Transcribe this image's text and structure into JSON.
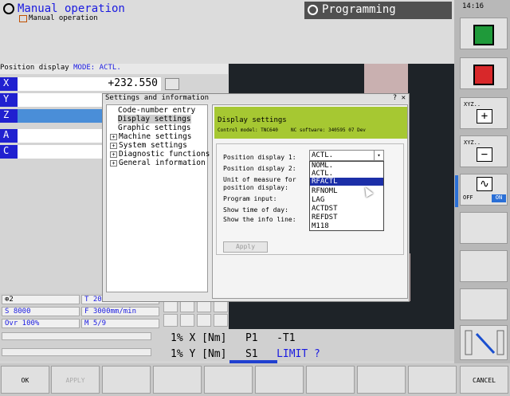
{
  "header": {
    "mode_title": "Manual operation",
    "mode_subtitle": "Manual operation",
    "programming_tab": "Programming",
    "clock": "14:16"
  },
  "position_display": {
    "label": "Position display",
    "mode_prefix": "MODE:",
    "mode_value": "ACTL.",
    "axes": [
      {
        "name": "X",
        "value": "+232.550"
      },
      {
        "name": "Y",
        "value": ""
      },
      {
        "name": "Z",
        "value": ""
      },
      {
        "name": "A",
        "value": ""
      },
      {
        "name": "C",
        "value": ""
      }
    ]
  },
  "settings_dialog": {
    "title": "Settings and information",
    "close_glyph": "? ✕",
    "tree": [
      {
        "label": "Code-number entry",
        "expandable": false
      },
      {
        "label": "Display settings",
        "expandable": false,
        "selected": true
      },
      {
        "label": "Graphic settings",
        "expandable": false
      },
      {
        "label": "Machine settings",
        "expandable": true
      },
      {
        "label": "System settings",
        "expandable": true
      },
      {
        "label": "Diagnostic functions",
        "expandable": true
      },
      {
        "label": "General information",
        "expandable": true
      }
    ],
    "panel": {
      "title": "Display settings",
      "model": "Control model: TNC640",
      "software": "NC software: 340595 07 Dev",
      "fields": [
        "Position display 1:",
        "Position display 2:",
        "Unit of measure for",
        "position display:",
        "Program input:",
        "Show time of day:",
        "Show the info line:"
      ],
      "apply_label": "Apply",
      "combo_value": "ACTL.",
      "combo_arrow": "▾",
      "dropdown_options": [
        "NOML.",
        "ACTL.",
        "RFACTL",
        "RFNOML",
        "LAG",
        "ACTDST",
        "REFDST",
        "M118"
      ],
      "dropdown_selected": "RFACTL"
    }
  },
  "status": {
    "tool_prefix": "⊕2",
    "tool": "T 20",
    "spindle": "S 8000",
    "feed": "F 3000mm/min",
    "override": "Ovr 100%",
    "mfunc": "M 5/9"
  },
  "override_lines": [
    {
      "pct": "1%",
      "axis": "X",
      "unit": "[Nm]",
      "key": "P1",
      "val": "-T1",
      "limit": ""
    },
    {
      "pct": "1%",
      "axis": "Y",
      "unit": "[Nm]",
      "key": "S1",
      "val": "",
      "limit": "LIMIT ?"
    }
  ],
  "softkeys": {
    "ok": "OK",
    "apply": "APPLY",
    "cancel": "CANCEL"
  },
  "vertical_softkeys": {
    "xyz_plus": "XYZ..",
    "xyz_minus": "XYZ..",
    "plus": "+",
    "minus": "−",
    "wave": "∿",
    "off": "OFF",
    "on": "ON"
  },
  "colors": {
    "accent_blue": "#1a1ae0",
    "axis_blue": "#2020d0",
    "panel_green": "#a6c832",
    "selection_blue": "#1c2fa8"
  }
}
